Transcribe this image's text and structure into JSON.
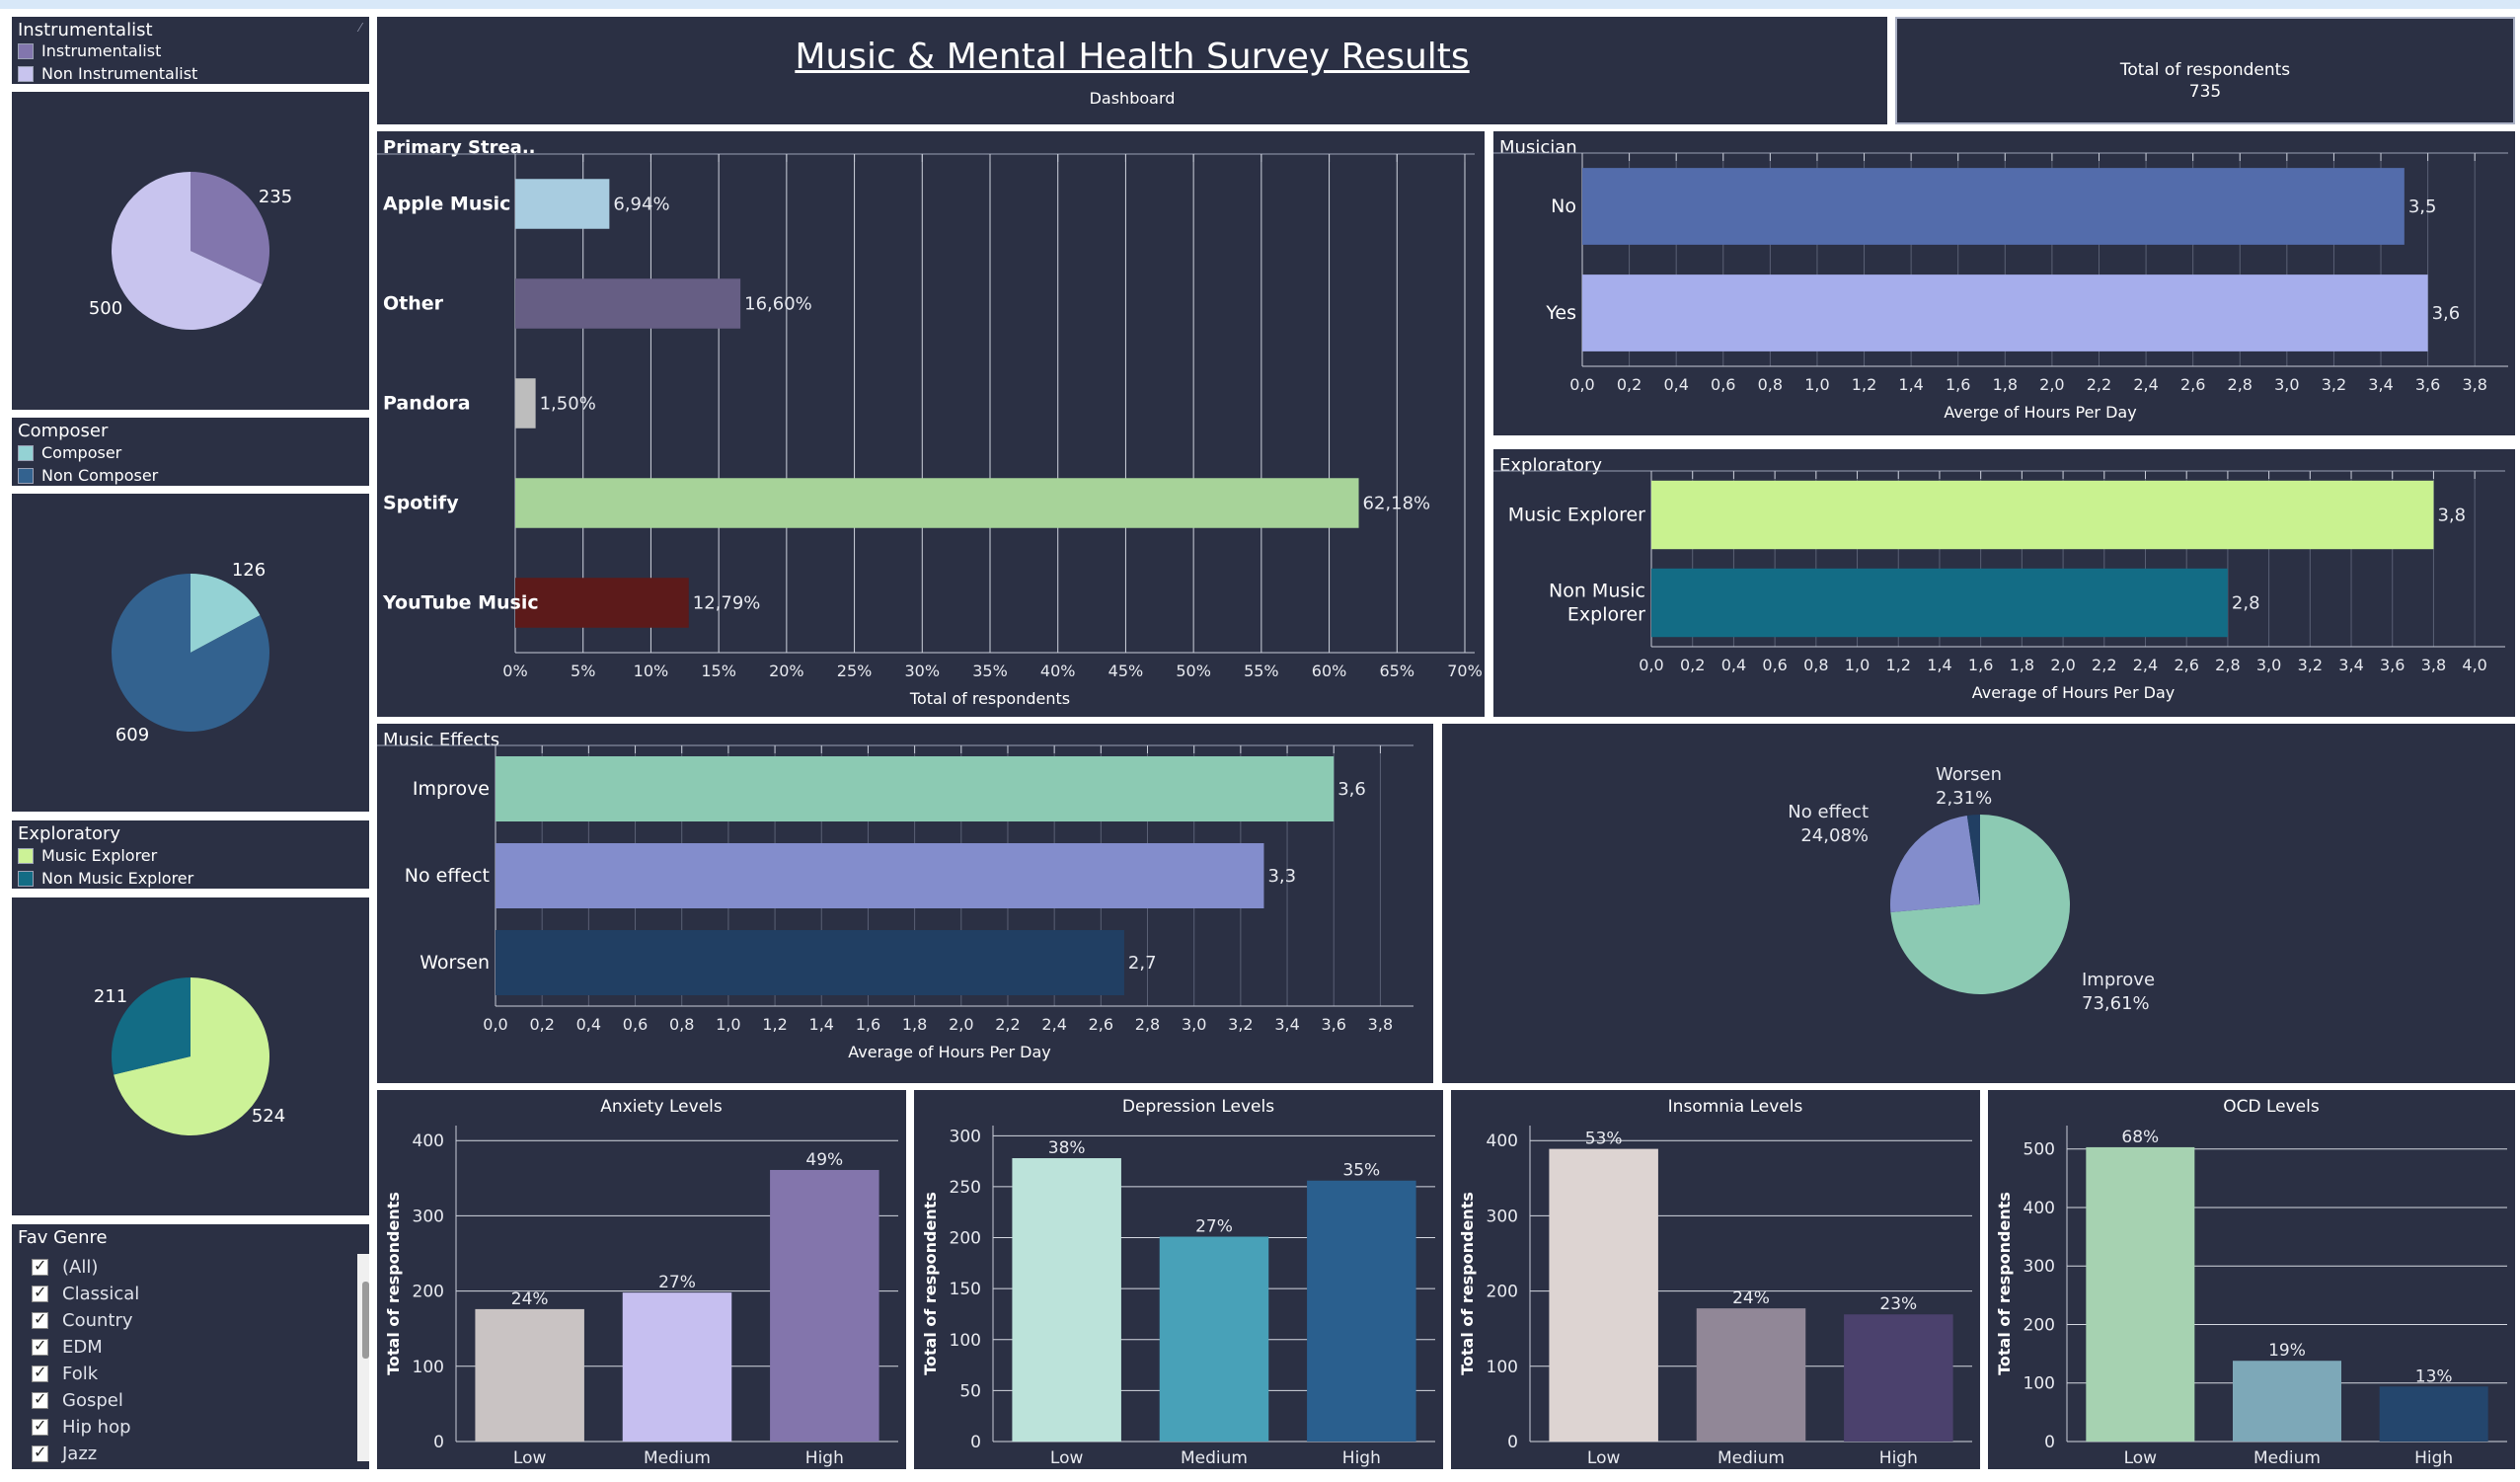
{
  "header": {
    "title": "Music & Mental Health Survey Results",
    "subtitle": "Dashboard"
  },
  "totals": {
    "label": "Total of respondents",
    "value": "735"
  },
  "legends": {
    "instrumentalist": {
      "title": "Instrumentalist",
      "items": [
        {
          "label": "Instrumentalist",
          "color": "#8276ad"
        },
        {
          "label": "Non Instrumentalist",
          "color": "#c8c4ee"
        }
      ]
    },
    "composer": {
      "title": "Composer",
      "items": [
        {
          "label": "Composer",
          "color": "#94d2d4"
        },
        {
          "label": "Non Composer",
          "color": "#33628f"
        }
      ]
    },
    "exploratory": {
      "title": "Exploratory",
      "items": [
        {
          "label": "Music Explorer",
          "color": "#ccf297"
        },
        {
          "label": "Non Music Explorer",
          "color": "#136c85"
        }
      ]
    }
  },
  "filter": {
    "title": "Fav Genre",
    "icon": "check-icon",
    "items": [
      "(All)",
      "Classical",
      "Country",
      "EDM",
      "Folk",
      "Gospel",
      "Hip hop",
      "Jazz"
    ]
  },
  "chart_data": [
    {
      "id": "pie-instrumentalist",
      "type": "pie",
      "values": [
        235,
        500
      ],
      "labels": [
        "235",
        "500"
      ],
      "colors": [
        "#8276ad",
        "#c8c4ee"
      ]
    },
    {
      "id": "pie-composer",
      "type": "pie",
      "values": [
        126,
        609
      ],
      "labels": [
        "126",
        "609"
      ],
      "colors": [
        "#94d2d4",
        "#33628f"
      ]
    },
    {
      "id": "pie-exploratory",
      "type": "pie",
      "values": [
        524,
        211
      ],
      "labels": [
        "524",
        "211"
      ],
      "colors": [
        "#ccf297",
        "#136c85"
      ]
    },
    {
      "id": "primary-streaming",
      "type": "bar",
      "orientation": "horizontal",
      "title": "Primary Strea..",
      "categories": [
        "Apple Music",
        "Other",
        "Pandora",
        "Spotify",
        "YouTube Music"
      ],
      "values": [
        6.94,
        16.6,
        1.5,
        62.18,
        12.79
      ],
      "value_labels": [
        "6,94%",
        "16,60%",
        "1,50%",
        "62,18%",
        "12,79%"
      ],
      "colors": [
        "#a8cce0",
        "#665e84",
        "#bdbdbd",
        "#a7d399",
        "#5c1a1a"
      ],
      "xlabel": "Total of respondents",
      "xticks": [
        "0%",
        "5%",
        "10%",
        "15%",
        "20%",
        "25%",
        "30%",
        "35%",
        "40%",
        "45%",
        "50%",
        "55%",
        "60%",
        "65%",
        "70%"
      ],
      "xlim": [
        0,
        70
      ]
    },
    {
      "id": "musician",
      "type": "bar",
      "orientation": "horizontal",
      "title": "Musician",
      "categories": [
        "No",
        "Yes"
      ],
      "values": [
        3.5,
        3.6
      ],
      "value_labels": [
        "3,5",
        "3,6"
      ],
      "colors": [
        "#536cab",
        "#a6aeec"
      ],
      "xlabel": "Averge of Hours Per Day",
      "xticks": [
        "0,0",
        "0,2",
        "0,4",
        "0,6",
        "0,8",
        "1,0",
        "1,2",
        "1,4",
        "1,6",
        "1,8",
        "2,0",
        "2,2",
        "2,4",
        "2,6",
        "2,8",
        "3,0",
        "3,2",
        "3,4",
        "3,6",
        "3,8"
      ],
      "xlim": [
        0,
        3.9
      ]
    },
    {
      "id": "exploratory-hours",
      "type": "bar",
      "orientation": "horizontal",
      "title": "Exploratory",
      "categories": [
        "Music Explorer",
        "Non Music Explorer"
      ],
      "values": [
        3.8,
        2.8
      ],
      "value_labels": [
        "3,8",
        "2,8"
      ],
      "colors": [
        "#c9f290",
        "#136c85"
      ],
      "xlabel": "Average of Hours Per Day",
      "xticks": [
        "0,0",
        "0,2",
        "0,4",
        "0,6",
        "0,8",
        "1,0",
        "1,2",
        "1,4",
        "1,6",
        "1,8",
        "2,0",
        "2,2",
        "2,4",
        "2,6",
        "2,8",
        "3,0",
        "3,2",
        "3,4",
        "3,6",
        "3,8",
        "4,0"
      ],
      "xlim": [
        0,
        4.1
      ]
    },
    {
      "id": "music-effects",
      "type": "bar",
      "orientation": "horizontal",
      "title": "Music Effects",
      "categories": [
        "Improve",
        "No effect",
        "Worsen"
      ],
      "values": [
        3.6,
        3.3,
        2.7
      ],
      "value_labels": [
        "3,6",
        "3,3",
        "2,7"
      ],
      "colors": [
        "#8ccab3",
        "#838dcc",
        "#213f63"
      ],
      "xlabel": "Average of Hours Per Day",
      "xticks": [
        "0,0",
        "0,2",
        "0,4",
        "0,6",
        "0,8",
        "1,0",
        "1,2",
        "1,4",
        "1,6",
        "1,8",
        "2,0",
        "2,2",
        "2,4",
        "2,6",
        "2,8",
        "3,0",
        "3,2",
        "3,4",
        "3,6",
        "3,8"
      ],
      "xlim": [
        0,
        3.9
      ]
    },
    {
      "id": "music-effects-pie",
      "type": "pie",
      "categories": [
        "Improve",
        "No effect",
        "Worsen"
      ],
      "values": [
        73.61,
        24.08,
        2.31
      ],
      "value_labels": [
        "73,61%",
        "24,08%",
        "2,31%"
      ],
      "colors": [
        "#8ccab3",
        "#838dcc",
        "#213f63"
      ]
    },
    {
      "id": "anxiety",
      "type": "bar",
      "title": "Anxiety Levels",
      "categories": [
        "Low",
        "Medium",
        "High"
      ],
      "values": [
        176,
        198,
        361
      ],
      "value_labels": [
        "24%",
        "27%",
        "49%"
      ],
      "colors": [
        "#c9c3c3",
        "#c6bff0",
        "#8375ac"
      ],
      "ylabel": "Total of respondents",
      "yticks": [
        0,
        100,
        200,
        300,
        400
      ],
      "ylim": [
        0,
        420
      ]
    },
    {
      "id": "depression",
      "type": "bar",
      "title": "Depression Levels",
      "categories": [
        "Low",
        "Medium",
        "High"
      ],
      "values": [
        278,
        201,
        256
      ],
      "value_labels": [
        "38%",
        "27%",
        "35%"
      ],
      "colors": [
        "#bce3da",
        "#48a1b8",
        "#2a5f8e"
      ],
      "ylabel": "Total of respondents",
      "yticks": [
        0,
        50,
        100,
        150,
        200,
        250,
        300
      ],
      "ylim": [
        0,
        310
      ]
    },
    {
      "id": "insomnia",
      "type": "bar",
      "title": "Insomnia Levels",
      "categories": [
        "Low",
        "Medium",
        "High"
      ],
      "values": [
        389,
        177,
        169
      ],
      "value_labels": [
        "53%",
        "24%",
        "23%"
      ],
      "colors": [
        "#ddd4d2",
        "#918797",
        "#4b416d"
      ],
      "ylabel": "Total of respondents",
      "yticks": [
        0,
        100,
        200,
        300,
        400
      ],
      "ylim": [
        0,
        420
      ]
    },
    {
      "id": "ocd",
      "type": "bar",
      "title": "OCD Levels",
      "categories": [
        "Low",
        "Medium",
        "High"
      ],
      "values": [
        503,
        138,
        94
      ],
      "value_labels": [
        "68%",
        "19%",
        "13%"
      ],
      "colors": [
        "#a6d2b1",
        "#7da8b8",
        "#24466d"
      ],
      "ylabel": "Total of respondents",
      "yticks": [
        0,
        100,
        200,
        300,
        400,
        500
      ],
      "ylim": [
        0,
        540
      ]
    }
  ]
}
